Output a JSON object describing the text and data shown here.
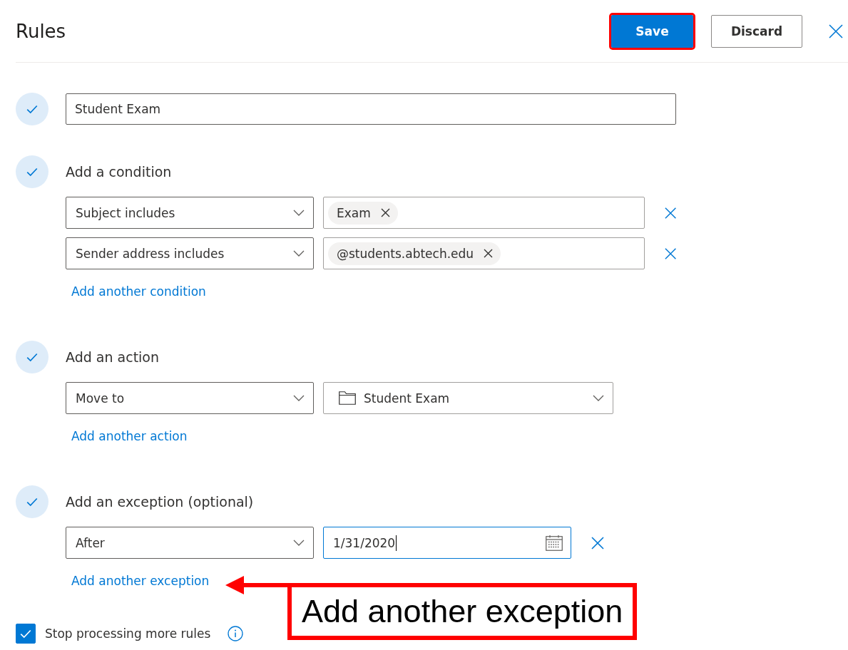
{
  "header": {
    "title": "Rules",
    "buttons": [
      {
        "label": "Save",
        "kind": "primary",
        "highlighted": true
      },
      {
        "label": "Discard",
        "kind": "secondary",
        "highlighted": false
      }
    ]
  },
  "steps": [
    {
      "kind": "name",
      "value": "Student Exam"
    },
    {
      "kind": "group",
      "title": "Add a condition",
      "rows": [
        {
          "kind": "tags",
          "selector": "Subject includes",
          "tags": [
            "Exam"
          ],
          "removable": true
        },
        {
          "kind": "tags",
          "selector": "Sender address includes",
          "tags": [
            "@students.abtech.edu"
          ],
          "removable": true
        }
      ],
      "add_link": "Add another condition"
    },
    {
      "kind": "group",
      "title": "Add an action",
      "rows": [
        {
          "kind": "folder",
          "selector": "Move to",
          "value": "Student Exam",
          "removable": false
        }
      ],
      "add_link": "Add another action"
    },
    {
      "kind": "group",
      "title": "Add an exception (optional)",
      "rows": [
        {
          "kind": "date",
          "selector": "After",
          "value": "1/31/2020",
          "focused": true,
          "removable": true
        }
      ],
      "add_link": "Add another exception"
    }
  ],
  "stop_processing": {
    "label": "Stop processing more rules",
    "checked": true
  },
  "annotation": {
    "text": "Add another exception"
  }
}
